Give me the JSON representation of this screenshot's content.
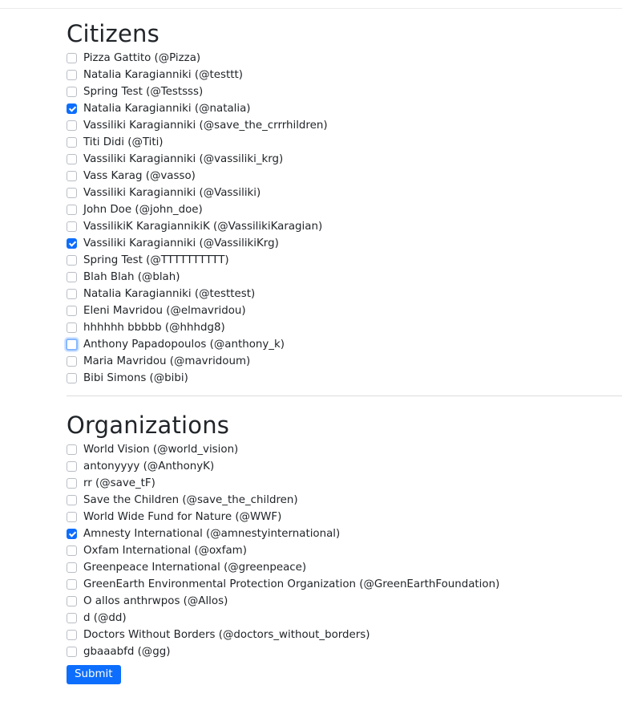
{
  "citizens": {
    "title": "Citizens",
    "items": [
      {
        "label": "Pizza Gattito (@Pizza)",
        "checked": false
      },
      {
        "label": "Natalia Karagianniki (@testtt)",
        "checked": false
      },
      {
        "label": "Spring Test (@Testsss)",
        "checked": false
      },
      {
        "label": "Natalia Karagianniki (@natalia)",
        "checked": true
      },
      {
        "label": "Vassiliki Karagianniki (@save_the_crrrhildren)",
        "checked": false
      },
      {
        "label": "Titi Didi (@Titi)",
        "checked": false
      },
      {
        "label": "Vassiliki Karagianniki (@vassiliki_krg)",
        "checked": false
      },
      {
        "label": "Vass Karag (@vasso)",
        "checked": false
      },
      {
        "label": "Vassiliki Karagianniki (@Vassiliki)",
        "checked": false
      },
      {
        "label": "John Doe (@john_doe)",
        "checked": false
      },
      {
        "label": "VassilikiK KaragiannikiK (@VassilikiKaragian)",
        "checked": false
      },
      {
        "label": "Vassiliki Karagianniki (@VassilikiKrg)",
        "checked": true
      },
      {
        "label": "Spring Test (@TTTTTTTTTT)",
        "checked": false
      },
      {
        "label": "Blah Blah (@blah)",
        "checked": false
      },
      {
        "label": "Natalia Karagianniki (@testtest)",
        "checked": false
      },
      {
        "label": "Eleni Mavridou (@elmavridou)",
        "checked": false
      },
      {
        "label": "hhhhhh bbbbb (@hhhdg8)",
        "checked": false
      },
      {
        "label": "Anthony Papadopoulos (@anthony_k)",
        "checked": false,
        "focused": true
      },
      {
        "label": "Maria Mavridou (@mavridoum)",
        "checked": false
      },
      {
        "label": "Bibi Simons (@bibi)",
        "checked": false
      }
    ]
  },
  "organizations": {
    "title": "Organizations",
    "items": [
      {
        "label": "World Vision (@world_vision)",
        "checked": false
      },
      {
        "label": "antonyyyy (@AnthonyK)",
        "checked": false
      },
      {
        "label": "rr (@save_tF)",
        "checked": false
      },
      {
        "label": "Save the Children (@save_the_children)",
        "checked": false
      },
      {
        "label": "World Wide Fund for Nature (@WWF)",
        "checked": false
      },
      {
        "label": "Amnesty International (@amnestyinternational)",
        "checked": true
      },
      {
        "label": "Oxfam International (@oxfam)",
        "checked": false
      },
      {
        "label": "Greenpeace International (@greenpeace)",
        "checked": false
      },
      {
        "label": "GreenEarth Environmental Protection Organization (@GreenEarthFoundation)",
        "checked": false
      },
      {
        "label": "O allos anthrwpos (@Allos)",
        "checked": false
      },
      {
        "label": "d (@dd)",
        "checked": false
      },
      {
        "label": "Doctors Without Borders (@doctors_without_borders)",
        "checked": false
      },
      {
        "label": "gbaaabfd (@gg)",
        "checked": false
      }
    ]
  },
  "form": {
    "submit_label": "Submit"
  },
  "colors": {
    "accent": "#0d6efd",
    "text": "#212529"
  }
}
